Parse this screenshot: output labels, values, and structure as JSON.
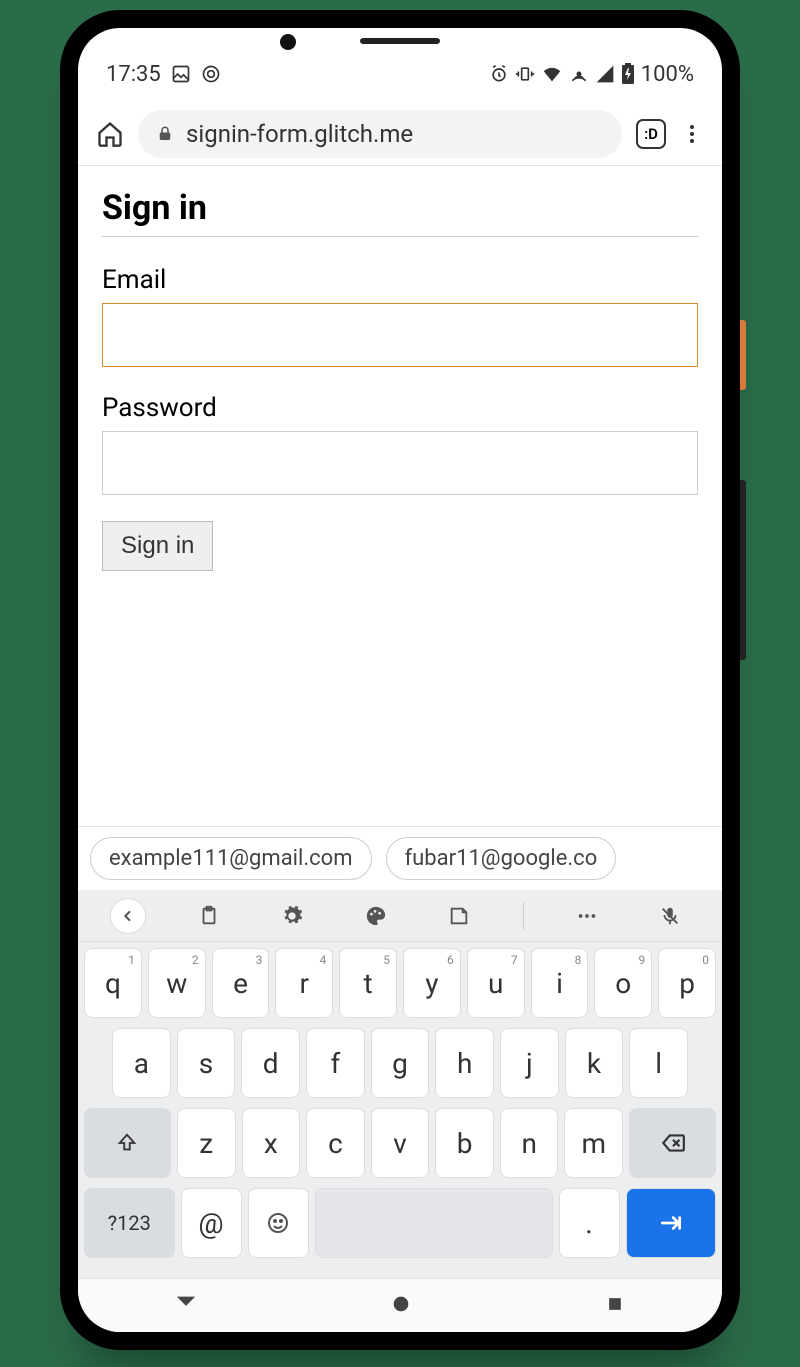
{
  "status": {
    "time": "17:35",
    "battery": "100%"
  },
  "browser": {
    "url": "signin-form.glitch.me",
    "tab_label": ":D"
  },
  "form": {
    "title": "Sign in",
    "email_label": "Email",
    "email_value": "",
    "password_label": "Password",
    "password_value": "",
    "submit_label": "Sign in"
  },
  "suggestions": [
    "example111@gmail.com",
    "fubar11@google.co"
  ],
  "keyboard": {
    "row1": [
      {
        "k": "q",
        "s": "1"
      },
      {
        "k": "w",
        "s": "2"
      },
      {
        "k": "e",
        "s": "3"
      },
      {
        "k": "r",
        "s": "4"
      },
      {
        "k": "t",
        "s": "5"
      },
      {
        "k": "y",
        "s": "6"
      },
      {
        "k": "u",
        "s": "7"
      },
      {
        "k": "i",
        "s": "8"
      },
      {
        "k": "o",
        "s": "9"
      },
      {
        "k": "p",
        "s": "0"
      }
    ],
    "row2": [
      "a",
      "s",
      "d",
      "f",
      "g",
      "h",
      "j",
      "k",
      "l"
    ],
    "row3": [
      "z",
      "x",
      "c",
      "v",
      "b",
      "n",
      "m"
    ],
    "sym_label": "?123",
    "at_label": "@",
    "period_label": "."
  }
}
